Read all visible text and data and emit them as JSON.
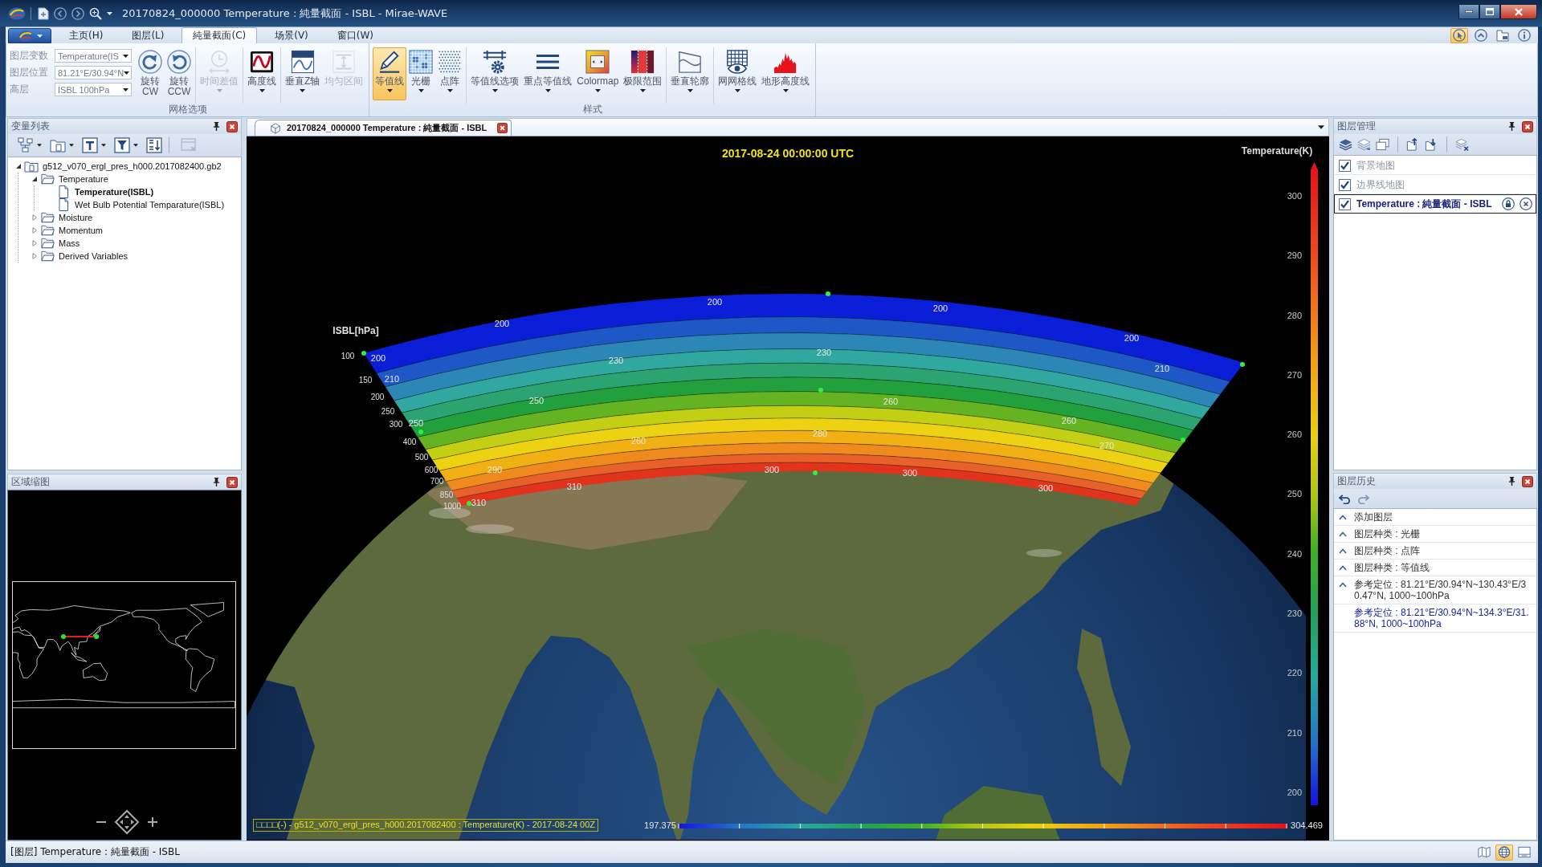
{
  "window": {
    "title": "20170824_000000 Temperature : 純量截面 - ISBL - Mirae-WAVE"
  },
  "ribbon": {
    "tabs": [
      {
        "label": "主页(H)",
        "selected": false
      },
      {
        "label": "图层(L)",
        "selected": false
      },
      {
        "label": "純量截面(C)",
        "selected": true
      },
      {
        "label": "场景(V)",
        "selected": false
      },
      {
        "label": "窗口(W)",
        "selected": false
      }
    ],
    "corner_buttons": [
      {
        "pressed": true
      },
      {
        "pressed": false
      },
      {
        "pressed": false
      },
      {
        "pressed": false
      }
    ],
    "groups": [
      {
        "label": "网格选项",
        "fields": [
          {
            "label": "图层变数",
            "value": "Temperature(IS"
          },
          {
            "label": "图层位置",
            "value": "81.21°E/30.94°N"
          },
          {
            "label": "高层",
            "value": "ISBL 100hPa"
          }
        ],
        "sections": [
          {
            "buttons": [
              {
                "label": "旋转",
                "sublabel": "CW",
                "dropdown": false,
                "disabled": false,
                "pressed": false
              },
              {
                "label": "旋转",
                "sublabel": "CCW",
                "dropdown": false,
                "disabled": false,
                "pressed": false
              }
            ]
          },
          {
            "buttons": [
              {
                "label": "时间差值",
                "dropdown": true,
                "disabled": true,
                "pressed": false
              }
            ]
          },
          {
            "buttons": [
              {
                "label": "高度线",
                "dropdown": true,
                "disabled": false,
                "pressed": false
              }
            ]
          },
          {
            "buttons": [
              {
                "label": "垂直Z轴",
                "dropdown": true,
                "disabled": false,
                "pressed": false
              },
              {
                "label": "均匀区间",
                "dropdown": false,
                "disabled": true,
                "pressed": false
              }
            ]
          }
        ]
      },
      {
        "label": "样式",
        "sections": [
          {
            "buttons": [
              {
                "label": "等值线",
                "dropdown": true,
                "disabled": false,
                "pressed": true
              },
              {
                "label": "光栅",
                "dropdown": true,
                "disabled": false,
                "pressed": false
              },
              {
                "label": "点阵",
                "dropdown": true,
                "disabled": false,
                "pressed": false
              }
            ]
          },
          {
            "buttons": [
              {
                "label": "等值线选项",
                "dropdown": true,
                "disabled": false,
                "pressed": false
              },
              {
                "label": "重点等值线",
                "dropdown": true,
                "disabled": false,
                "pressed": false
              },
              {
                "label": "Colormap",
                "dropdown": true,
                "disabled": false,
                "pressed": false
              },
              {
                "label": "极限范围",
                "dropdown": true,
                "disabled": false,
                "pressed": false
              }
            ]
          },
          {
            "buttons": [
              {
                "label": "垂直轮廓",
                "dropdown": true,
                "disabled": false,
                "pressed": false
              }
            ]
          },
          {
            "buttons": [
              {
                "label": "网网格线",
                "dropdown": true,
                "disabled": false,
                "pressed": false
              },
              {
                "label": "地形高度线",
                "dropdown": true,
                "disabled": false,
                "pressed": false
              }
            ]
          }
        ]
      }
    ]
  },
  "variable_list": {
    "title": "变量列表",
    "tools": [
      {
        "disabled": false
      },
      {
        "disabled": false
      },
      {
        "disabled": false
      },
      {
        "disabled": false
      },
      {
        "disabled": false
      },
      {
        "disabled": true
      }
    ],
    "tree": [
      {
        "label": "g512_v070_ergl_pres_h000.2017082400.gb2",
        "expanded": true,
        "selected": false,
        "children": [
          {
            "label": "Temperature",
            "expanded": true,
            "selected": false,
            "children": [
              {
                "label": "Temperature(ISBL)",
                "selected": true
              },
              {
                "label": "Wet Bulb Potential Temparature(ISBL)",
                "selected": false
              }
            ]
          },
          {
            "label": "Moisture",
            "expanded": false,
            "selected": false
          },
          {
            "label": "Momentum",
            "expanded": false,
            "selected": false
          },
          {
            "label": "Mass",
            "expanded": false,
            "selected": false
          },
          {
            "label": "Derived Variables",
            "expanded": false,
            "selected": false
          }
        ]
      }
    ]
  },
  "overview_map": {
    "title": "区域缩图"
  },
  "document": {
    "tab": "20170824_000000 Temperature : 純量截面 - ISBL",
    "view": {
      "title": "2017-08-24 00:00:00 UTC",
      "axis": {
        "title": "ISBL[hPa]",
        "ticks": [
          "100",
          "150",
          "200",
          "250",
          "300",
          "400",
          "500",
          "600",
          "700",
          "850",
          "1000"
        ]
      },
      "contour_labels": [
        "200",
        "200",
        "200",
        "200",
        "200",
        "230",
        "230",
        "210",
        "210",
        "250",
        "260",
        "260",
        "250",
        "280",
        "260",
        "270",
        "290",
        "300",
        "300",
        "310",
        "300",
        "310"
      ],
      "legend": {
        "title": "Temperature(K)",
        "ticks": [
          "300",
          "290",
          "280",
          "270",
          "260",
          "250",
          "240",
          "230",
          "220",
          "210",
          "200"
        ]
      },
      "info": "□□□□(-) - g512_v070_ergl_pres_h000.2017082400 : Temperature(K) - 2017-08-24 00Z",
      "range": {
        "min": "197.375",
        "max": "304.469"
      }
    }
  },
  "layer_manager": {
    "title": "图层管理",
    "layers": [
      {
        "label": "背景地图",
        "checked": true,
        "disabled": true,
        "selected": false
      },
      {
        "label": "边界线地图",
        "checked": true,
        "disabled": true,
        "selected": false
      },
      {
        "label": "Temperature : 純量截面 - ISBL",
        "checked": true,
        "disabled": false,
        "selected": true
      }
    ]
  },
  "layer_history": {
    "title": "图层历史",
    "undo": {
      "disabled": false
    },
    "redo": {
      "disabled": true
    },
    "items": [
      {
        "label": "添加图层",
        "selected": false
      },
      {
        "label": "图层种类 : 光栅",
        "selected": false
      },
      {
        "label": "图层种类 : 点阵",
        "selected": false
      },
      {
        "label": "图层种类 : 等值线",
        "selected": false
      },
      {
        "label": "参考定位 : 81.21°E/30.94°N~130.43°E/30.47°N, 1000~100hPa",
        "selected": false
      },
      {
        "label": "参考定位 : 81.21°E/30.94°N~134.3°E/31.88°N, 1000~100hPa",
        "selected": true
      }
    ]
  },
  "status_bar": {
    "text": "[图层] Temperature : 純量截面 - ISBL",
    "buttons": [
      {
        "pressed": false
      },
      {
        "pressed": true
      },
      {
        "pressed": false
      }
    ]
  }
}
